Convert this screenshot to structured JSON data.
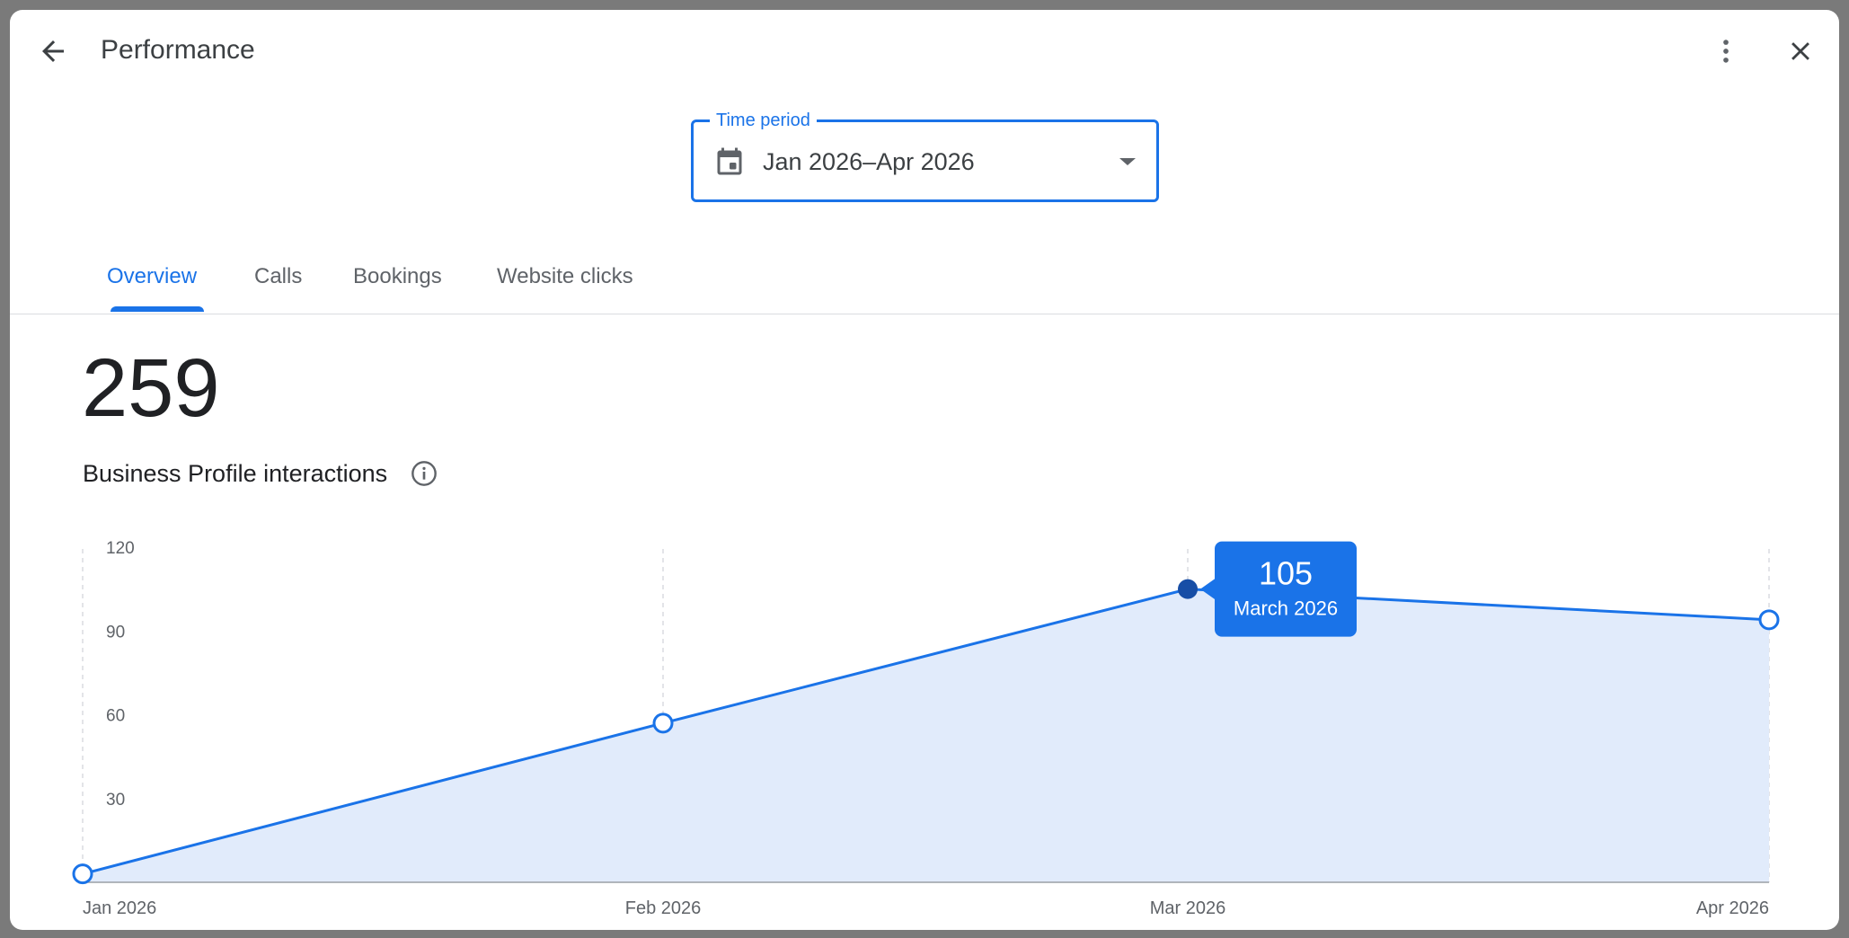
{
  "header": {
    "title": "Performance"
  },
  "time_period": {
    "label": "Time period",
    "value": "Jan 2026–Apr 2026"
  },
  "tabs": [
    {
      "label": "Overview",
      "active": true
    },
    {
      "label": "Calls",
      "active": false
    },
    {
      "label": "Bookings",
      "active": false
    },
    {
      "label": "Website clicks",
      "active": false
    }
  ],
  "summary": {
    "total": "259",
    "label": "Business Profile interactions"
  },
  "tooltip": {
    "value": "105",
    "label": "March 2026"
  },
  "icons": {
    "back": "arrow-left-icon",
    "more": "more-vert-icon",
    "close": "close-icon",
    "calendar": "calendar-icon",
    "dropdown": "caret-down-icon",
    "info": "info-icon"
  },
  "colors": {
    "accent": "#1a73e8",
    "area_fill": "#e1ebfb",
    "highlight_point": "#174ea6"
  },
  "chart_data": {
    "type": "area",
    "categories": [
      "Jan 2026",
      "Feb 2026",
      "Mar 2026",
      "Apr 2026"
    ],
    "values": [
      3,
      57,
      105,
      94
    ],
    "yticks": [
      30,
      60,
      90,
      120
    ],
    "ylim": [
      0,
      120
    ],
    "highlight_index": 2,
    "grid": "vertical-dashed"
  }
}
